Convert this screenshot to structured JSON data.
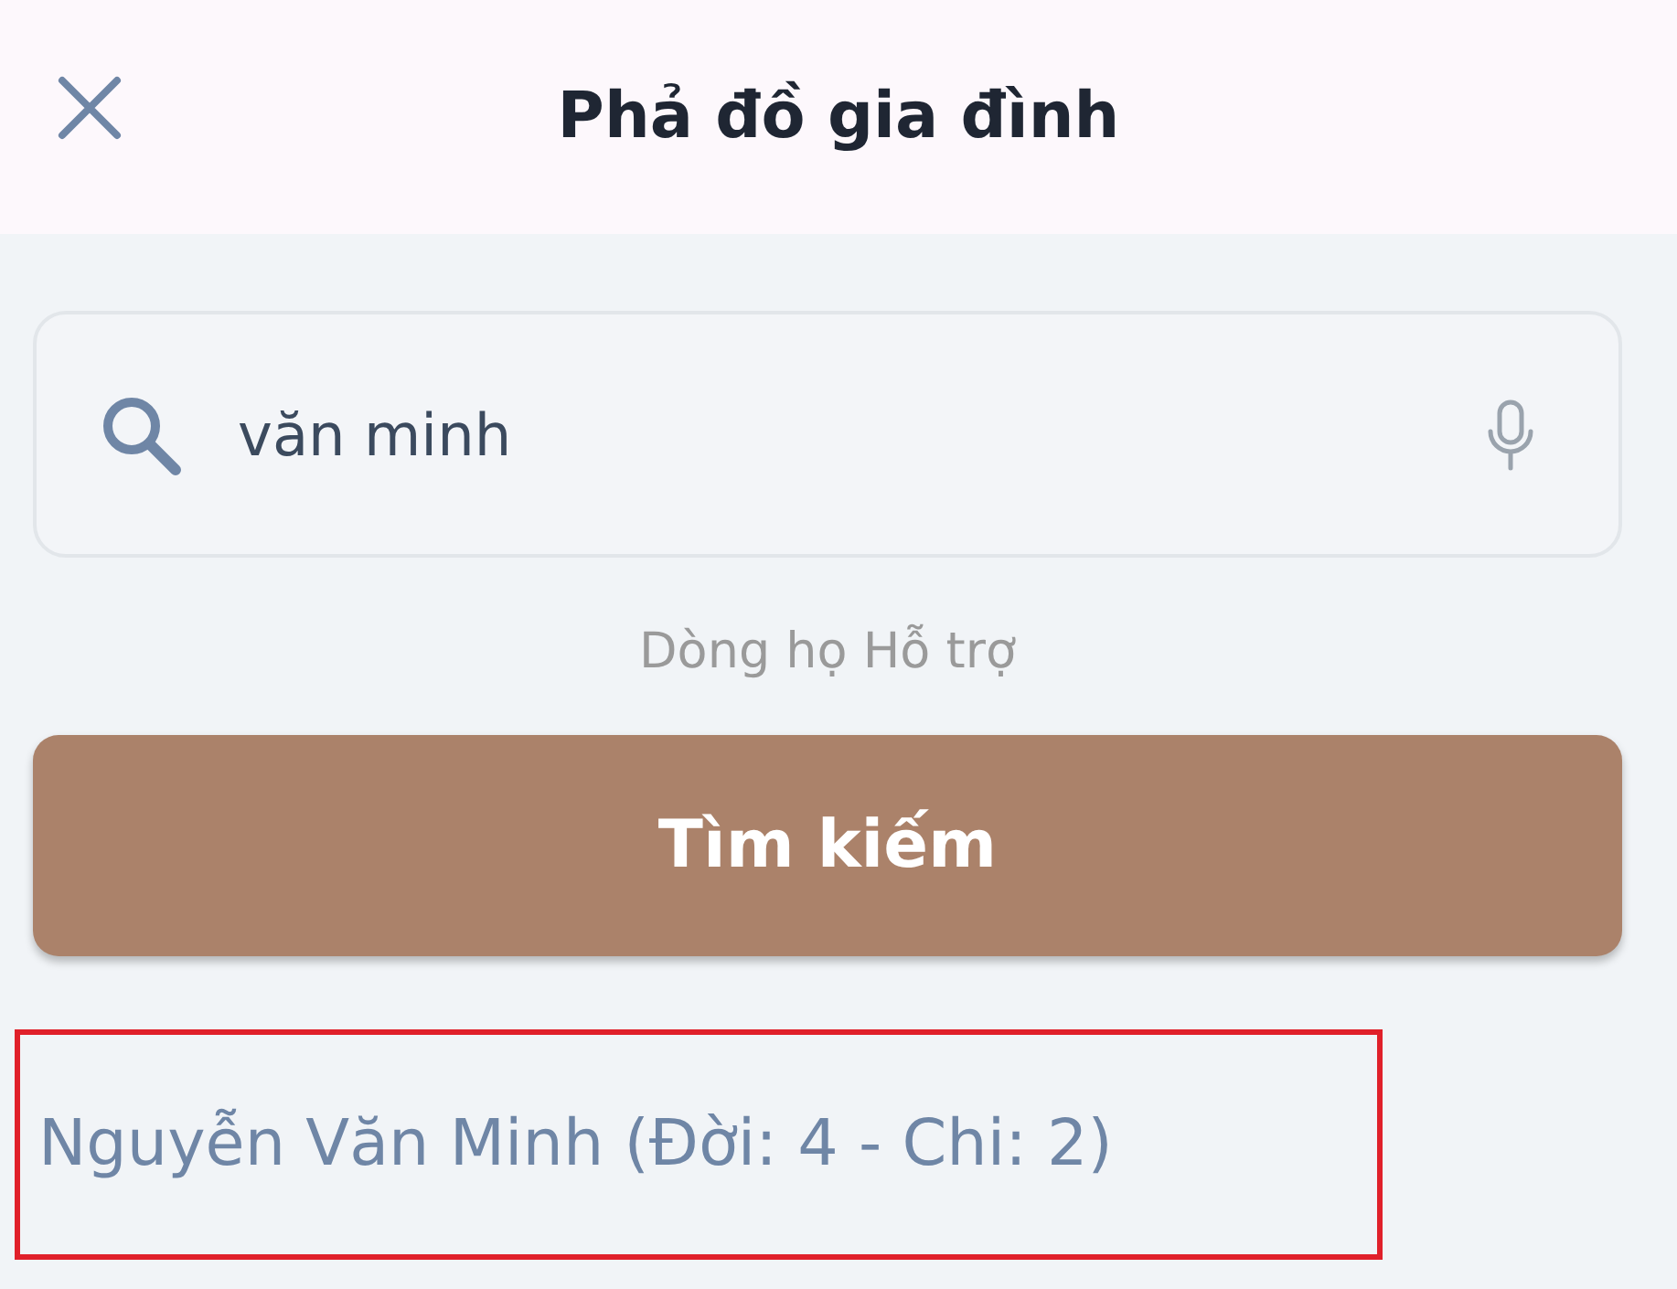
{
  "header": {
    "title": "Phả đồ gia đình"
  },
  "search": {
    "value": "văn minh"
  },
  "hint": "Dòng họ Hỗ trợ",
  "search_button": {
    "label": "Tìm kiếm"
  },
  "results": [
    {
      "label": "Nguyễn Văn Minh (Đời: 4 - Chi: 2)",
      "highlighted": true
    }
  ]
}
